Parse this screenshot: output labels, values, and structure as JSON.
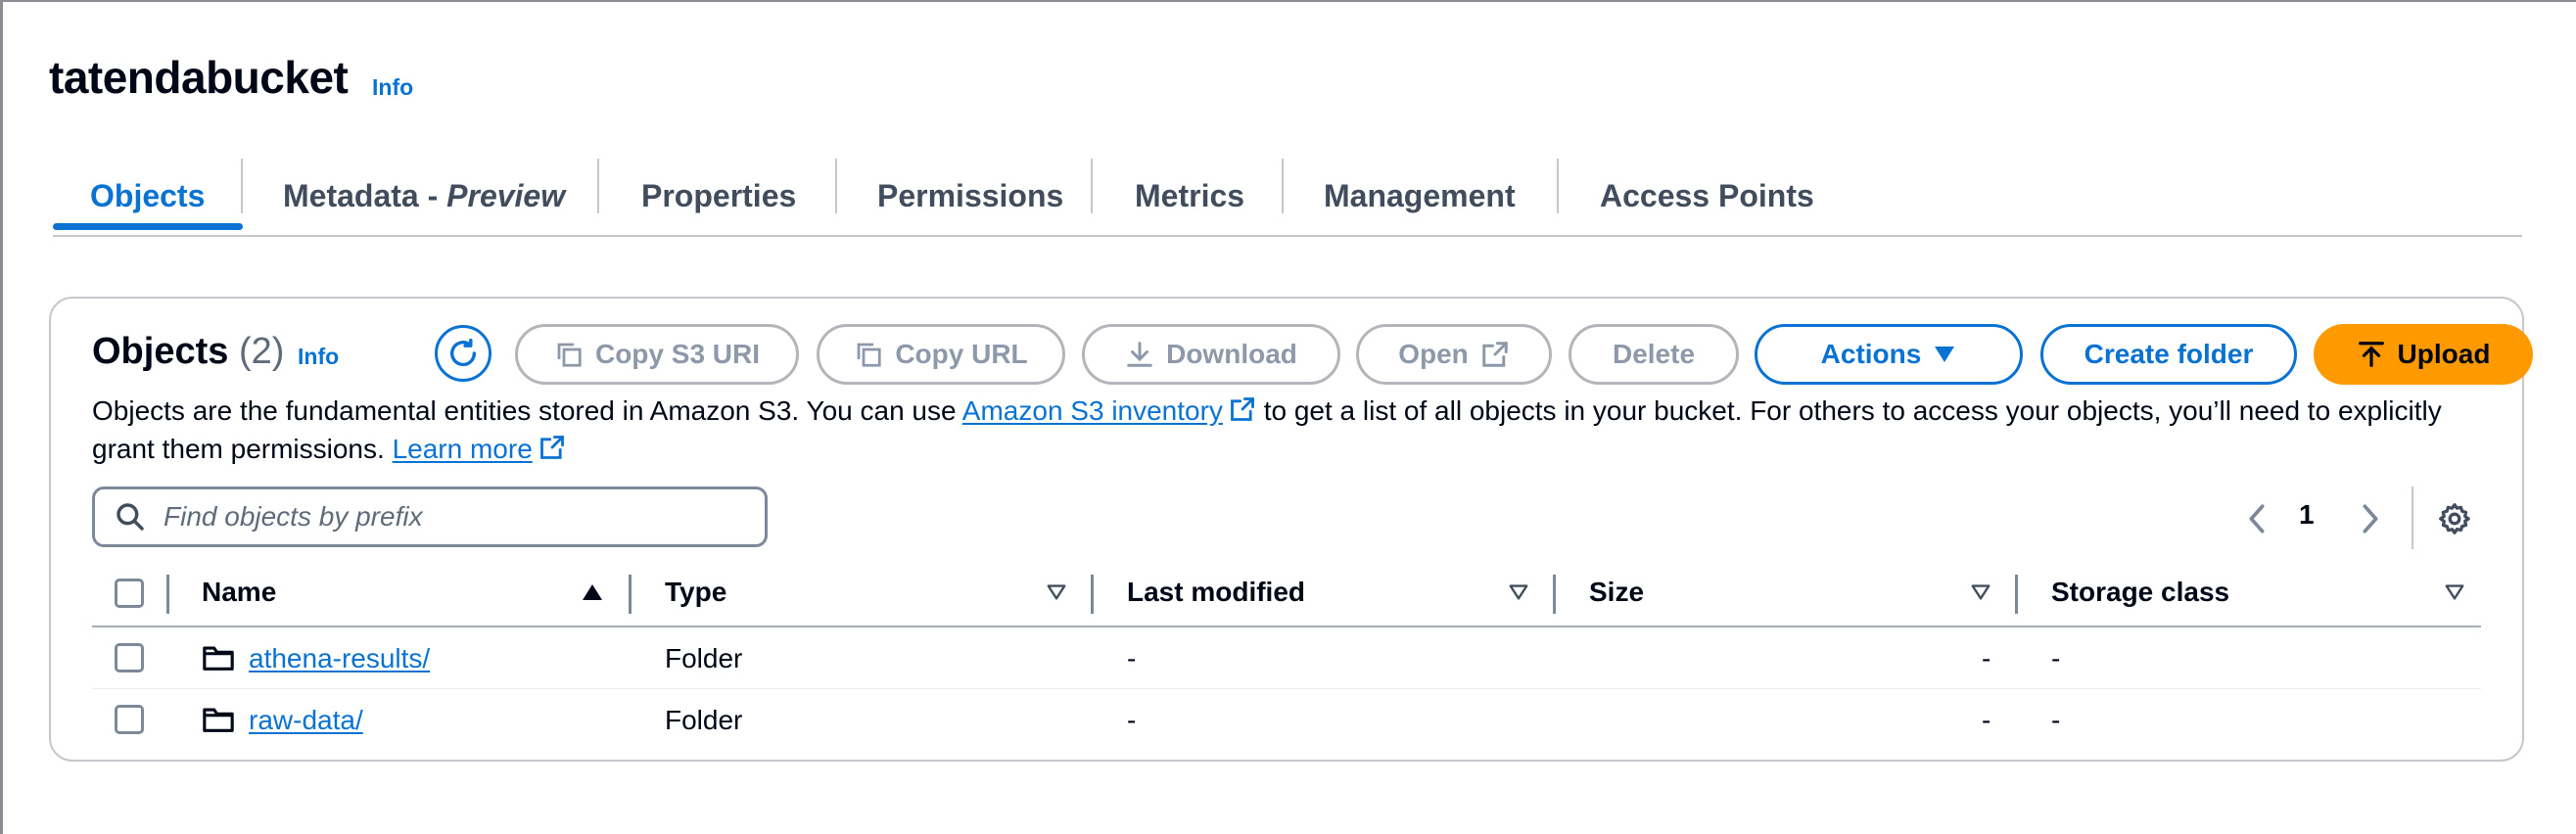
{
  "bucket": {
    "name": "tatendabucket",
    "info_label": "Info"
  },
  "tabs": [
    {
      "label": "Objects"
    },
    {
      "label": "Metadata - ",
      "label_italic": "Preview"
    },
    {
      "label": "Properties"
    },
    {
      "label": "Permissions"
    },
    {
      "label": "Metrics"
    },
    {
      "label": "Management"
    },
    {
      "label": "Access Points"
    }
  ],
  "objects_panel": {
    "title": "Objects",
    "count": "(2)",
    "info_label": "Info",
    "buttons": {
      "copy_s3_uri": "Copy S3 URI",
      "copy_url": "Copy URL",
      "download": "Download",
      "open": "Open",
      "delete": "Delete",
      "actions": "Actions",
      "create_folder": "Create folder",
      "upload": "Upload"
    },
    "description": {
      "part1": "Objects are the fundamental entities stored in Amazon S3. You can use ",
      "link1": "Amazon S3 inventory",
      "part2": " to get a list of all objects in your bucket. For others to access your objects, you’ll need to explicitly grant them permissions. ",
      "link2": "Learn more"
    },
    "search_placeholder": "Find objects by prefix",
    "page_number": "1",
    "columns": [
      "Name",
      "Type",
      "Last modified",
      "Size",
      "Storage class"
    ],
    "rows": [
      {
        "name": "athena-results/",
        "type": "Folder",
        "last_modified": "-",
        "size": "-",
        "storage_class": "-"
      },
      {
        "name": "raw-data/",
        "type": "Folder",
        "last_modified": "-",
        "size": "-",
        "storage_class": "-"
      }
    ]
  },
  "colors": {
    "accent": "#0972d3",
    "upload": "#ff9900",
    "disabled": "#8d99a8",
    "border": "#c6c6cd"
  }
}
